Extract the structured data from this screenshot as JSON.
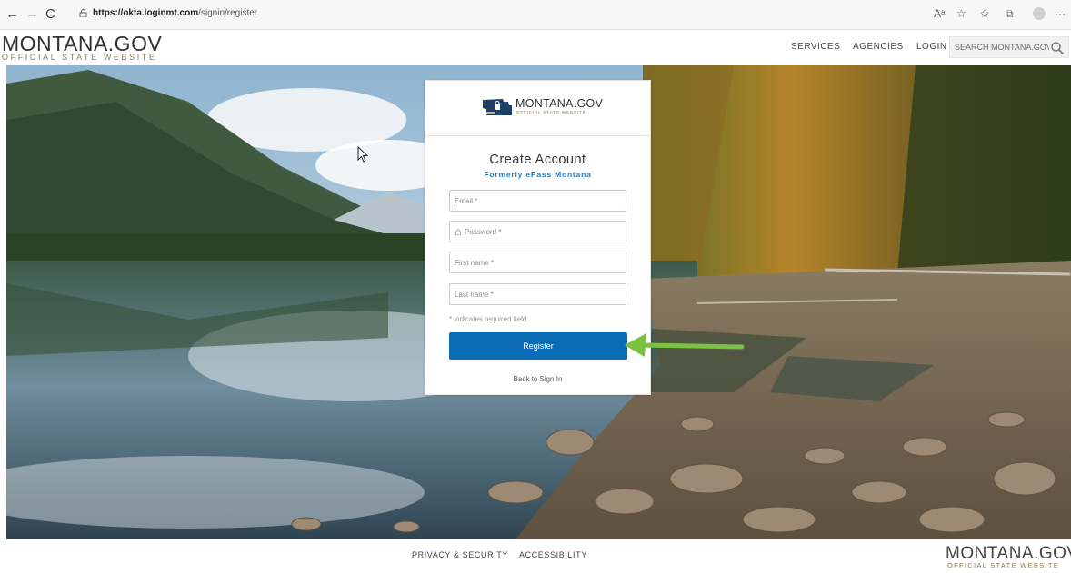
{
  "browser": {
    "url_host": "https://okta.loginmt.com",
    "url_path": "/signin/register",
    "back_icon": "←",
    "forward_icon": "→",
    "reload_icon": "C",
    "read_aloud_icon": "Aᵃ",
    "favorites_add_icon": "☆",
    "favorites_icon": "✩",
    "collections_icon": "⧉",
    "more_icon": "···"
  },
  "header": {
    "logo_main": "MONTANA.GOV",
    "logo_sub": "OFFICIAL STATE WEBSITE",
    "nav": [
      "SERVICES",
      "AGENCIES",
      "LOGIN"
    ],
    "search_placeholder": "SEARCH MONTANA.GOV"
  },
  "card": {
    "brand_name": "MONTANA.GOV",
    "brand_sub": "OFFICIAL STATE WEBSITE",
    "title": "Create Account",
    "subtitle": "Formerly ePass Montana",
    "fields": {
      "email": "Email *",
      "password": "Password *",
      "first_name": "First name *",
      "last_name": "Last name *"
    },
    "required_note": "* indicates required field",
    "register_label": "Register",
    "back_label": "Back to Sign In"
  },
  "footer": {
    "links": [
      "PRIVACY & SECURITY",
      "ACCESSIBILITY"
    ],
    "logo_main": "MONTANA.GOV",
    "logo_sub": "OFFICIAL STATE WEBSITE"
  },
  "colors": {
    "button": "#0b6cb4",
    "subtitle": "#1d7ac3",
    "arrow": "#7ac142",
    "gold": "#8d7a52"
  }
}
